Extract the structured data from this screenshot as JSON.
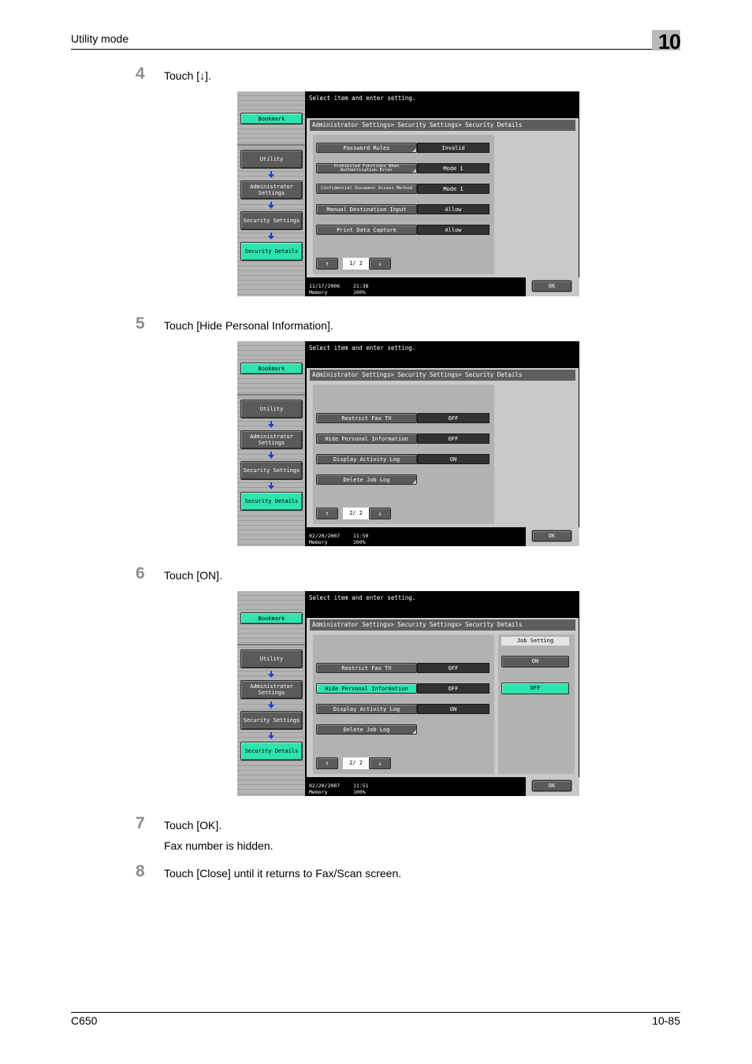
{
  "page": {
    "header_title": "Utility mode",
    "chapter": "10",
    "footer_model": "C650",
    "footer_page": "10-85"
  },
  "steps": [
    {
      "num": "4",
      "text": "Touch [↓]."
    },
    {
      "num": "5",
      "text": "Touch [Hide Personal Information]."
    },
    {
      "num": "6",
      "text": "Touch [ON]."
    },
    {
      "num": "7",
      "text": "Touch [OK].",
      "note": "Fax number is hidden."
    },
    {
      "num": "8",
      "text": "Touch [Close] until it returns to Fax/Scan screen."
    }
  ],
  "screen_common": {
    "message": "Select item and enter setting.",
    "bookmark": "Bookmark",
    "nav": [
      "Utility",
      "Administrator Settings",
      "Security Settings",
      "Security Details"
    ],
    "breadcrumb": "Administrator Settings> Security Settings> Security Details",
    "memory_label": "Memory",
    "memory_value": "100%",
    "ok": "OK",
    "up_arrow": "↑",
    "down_arrow": "↓",
    "accent_color": "#2ee3ae"
  },
  "screens": [
    {
      "items": [
        {
          "label": "Password Rules",
          "value": "Invalid"
        },
        {
          "label": "Prohibited Functions When Authentication Error",
          "value": "Mode 1"
        },
        {
          "label": "Confidential Document Access Method",
          "value": "Mode 1"
        },
        {
          "label": "Manual Destination Input",
          "value": "Allow"
        },
        {
          "label": "Print Data Capture",
          "value": "Allow"
        }
      ],
      "page": "1/ 2",
      "date": "11/17/2006",
      "time": "21:38"
    },
    {
      "items": [
        {
          "label": "Restrict Fax TX",
          "value": "OFF"
        },
        {
          "label": "Hide Personal Information",
          "value": "OFF"
        },
        {
          "label": "Display Activity Log",
          "value": "ON"
        },
        {
          "label": "Delete Job Log",
          "value": ""
        }
      ],
      "page": "2/ 2",
      "date": "02/20/2007",
      "time": "11:50"
    },
    {
      "items": [
        {
          "label": "Restrict Fax TX",
          "value": "OFF"
        },
        {
          "label": "Hide Personal Information",
          "value": "OFF",
          "selected": true
        },
        {
          "label": "Display Activity Log",
          "value": "ON"
        },
        {
          "label": "Delete Job Log",
          "value": ""
        }
      ],
      "page": "2/ 2",
      "date": "02/20/2007",
      "time": "11:51",
      "job_setting": {
        "title": "Job Setting",
        "on": "ON",
        "off": "OFF",
        "selected": "OFF"
      }
    }
  ]
}
